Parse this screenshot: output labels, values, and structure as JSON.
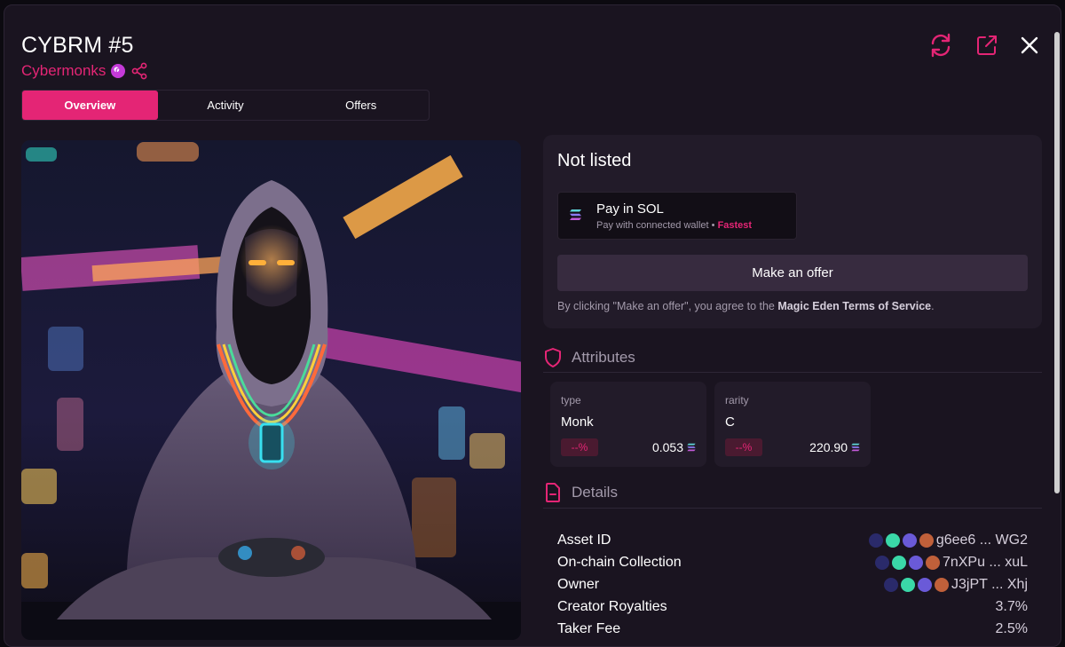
{
  "header": {
    "title": "CYBRM #5",
    "collection": "Cybermonks"
  },
  "tabs": [
    {
      "label": "Overview",
      "active": true
    },
    {
      "label": "Activity",
      "active": false
    },
    {
      "label": "Offers",
      "active": false
    }
  ],
  "listing": {
    "status": "Not listed",
    "pay_title": "Pay in SOL",
    "pay_sub": "Pay with connected wallet",
    "pay_dot": "•",
    "pay_fast": "Fastest",
    "offer_button": "Make an offer",
    "tos_prefix": "By clicking \"Make an offer\", you agree to the ",
    "tos_link": "Magic Eden Terms of Service",
    "tos_suffix": "."
  },
  "attributes": {
    "heading": "Attributes",
    "items": [
      {
        "key": "type",
        "value": "Monk",
        "pct": "--%",
        "price": "0.053"
      },
      {
        "key": "rarity",
        "value": "C",
        "pct": "--%",
        "price": "220.90"
      }
    ]
  },
  "details": {
    "heading": "Details",
    "rows": [
      {
        "label": "Asset ID",
        "value": "g6ee6 ... WG2"
      },
      {
        "label": "On-chain Collection",
        "value": "7nXPu ... xuL"
      },
      {
        "label": "Owner",
        "value": "J3jPT ... Xhj"
      },
      {
        "label": "Creator Royalties",
        "value": "3.7%"
      },
      {
        "label": "Taker Fee",
        "value": "2.5%"
      }
    ]
  },
  "colors": {
    "accent": "#e42575",
    "panel": "#221b29",
    "modal": "#1a1420"
  },
  "icons": [
    "refresh-icon",
    "external-link-icon",
    "close-icon",
    "share-icon",
    "verified-badge-icon",
    "shield-icon",
    "document-icon",
    "solana-icon"
  ]
}
